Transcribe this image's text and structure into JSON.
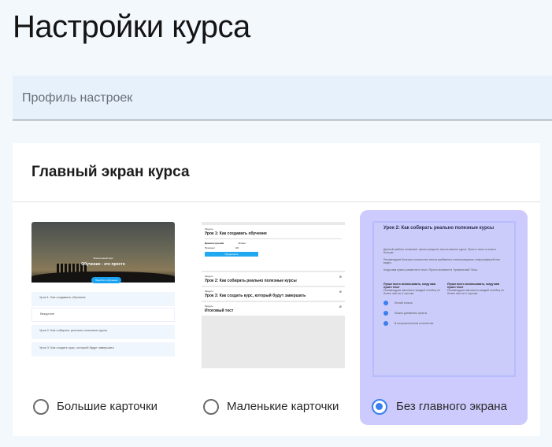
{
  "page_title": "Настройки курса",
  "profile_field": {
    "placeholder": "Профиль настроек"
  },
  "section": {
    "title": "Главный экран курса"
  },
  "options": [
    {
      "label": "Большие карточки",
      "selected": false,
      "thumb": {
        "subtitle": "Электронный курс",
        "hero_title": "Обучение - это просто",
        "button": "Перейти к обучению",
        "items": [
          "Урок 1: Как создавать обучение",
          "Введение",
          "Урок 2: Как собирать реально полезные курсы",
          "Урок 3: Как создать курс, который будут завершать"
        ]
      }
    },
    {
      "label": "Маленькие карточки",
      "selected": false,
      "thumb": {
        "module_label": "Модуль",
        "lesson1": "Урок 1: Как создавать обучение",
        "time_label": "Время изучения",
        "time_value": "10 мин",
        "progress_label": "Прогресс",
        "progress_value": "0/2",
        "button": "Продолжить",
        "lesson2": "Урок 2: Как собирать реально полезные курсы",
        "lesson3": "Урок 3: Как создать курс, который будут завершать",
        "final": "Итоговый тест"
      }
    },
    {
      "label": "Без главного экрана",
      "selected": true,
      "thumb": {
        "title": "Урок 2: Как собирать реально полезные курсы",
        "para1": "Данный шаблон позволяет лучше раскрыть мысль вашего курса. Просто текст и ничего больше.",
        "para2": "Рекомендуем большое количество текста разбавлять иллюстрациями, инфографикой или видео.",
        "para3": "Когда вам нужно разместить текст. Просто вставьте в \"правильный\" блок.",
        "col_head": "Лучше всего использовать, когду вам нужен текст",
        "col_text": "Рекомендуем заполнять каждый столбец не более чем на 4 строчки.",
        "checks": [
          "Легкий список",
          "Можно добавлять пункты",
          "В неограниченном количестве"
        ]
      }
    }
  ]
}
